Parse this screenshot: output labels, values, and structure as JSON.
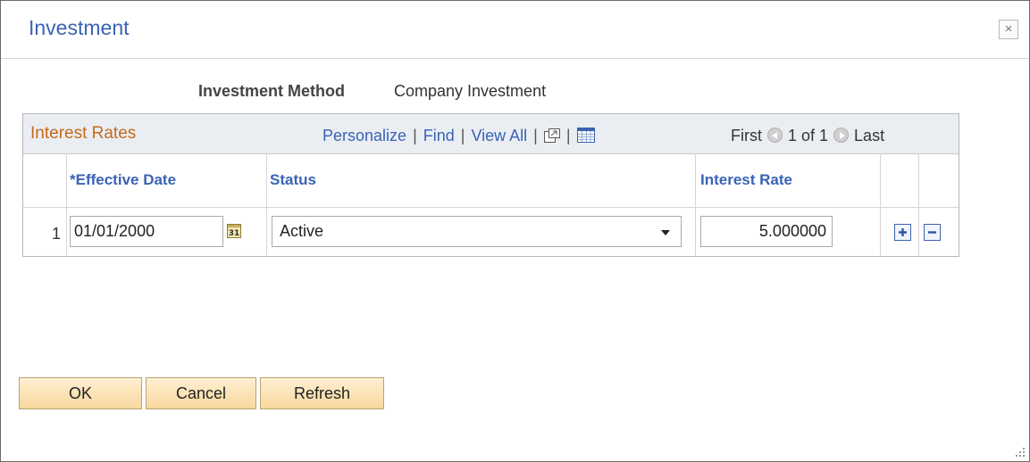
{
  "dialog": {
    "title": "Investment",
    "close_label": "×"
  },
  "method": {
    "label": "Investment Method",
    "value": "Company Investment"
  },
  "grid": {
    "title": "Interest Rates",
    "links": {
      "personalize": "Personalize",
      "find": "Find",
      "view_all": "View All",
      "separator": "|"
    },
    "pager": {
      "first": "First",
      "range": "1 of 1",
      "last": "Last"
    },
    "columns": {
      "effective_date": "*Effective Date",
      "status": "Status",
      "interest_rate": "Interest Rate"
    },
    "rows": [
      {
        "num": "1",
        "effective_date": "01/01/2000",
        "status": "Active",
        "interest_rate": "5.000000"
      }
    ]
  },
  "buttons": {
    "ok": "OK",
    "cancel": "Cancel",
    "refresh": "Refresh"
  },
  "icons": {
    "zoom": "zoom-icon",
    "download": "download-icon",
    "calendar": "calendar-icon",
    "add_row": "add-row-icon",
    "delete_row": "delete-row-icon",
    "prev": "prev-arrow-icon",
    "next": "next-arrow-icon"
  },
  "colors": {
    "link": "#3a63b5",
    "grid_title": "#c76a1a",
    "button_fill": "#f8d79d"
  }
}
